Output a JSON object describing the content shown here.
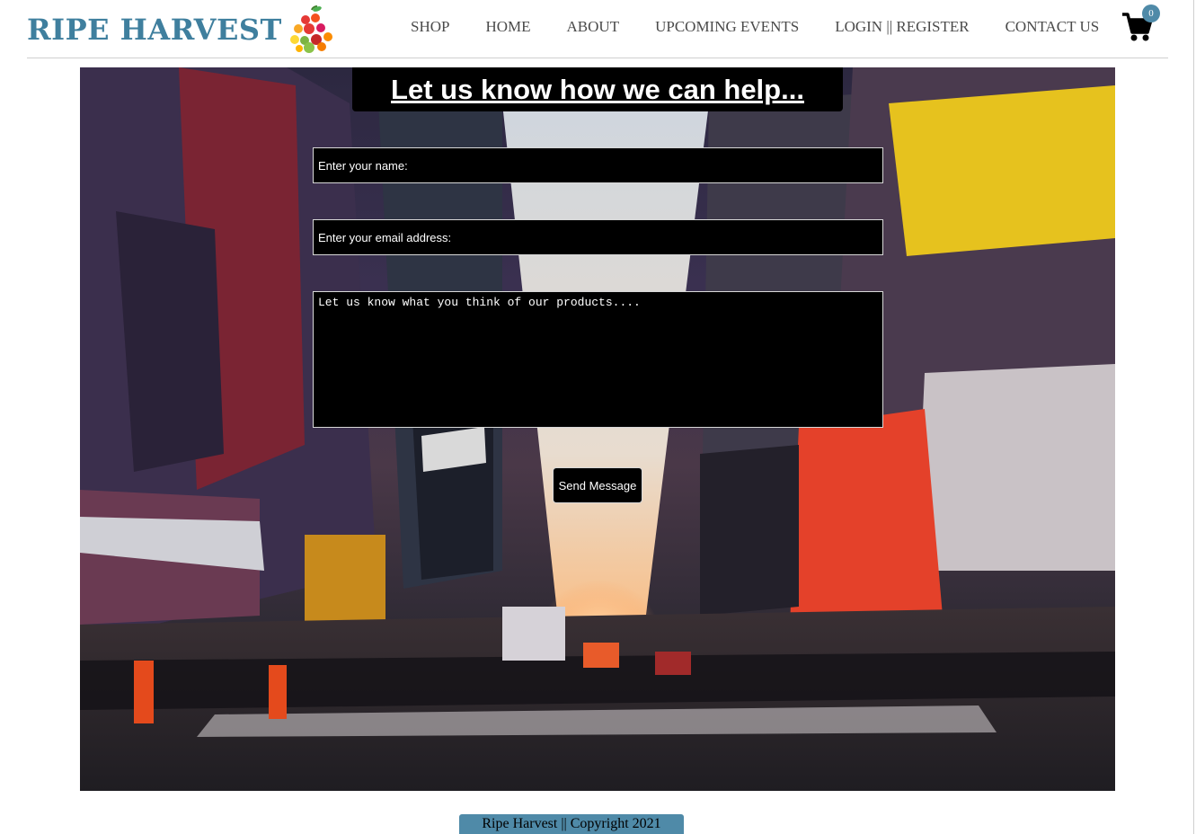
{
  "header": {
    "brand_name": "RIPE HARVEST",
    "logo_icon": "fruit-cluster-logo-icon",
    "nav": [
      {
        "label": "SHOP"
      },
      {
        "label": "HOME"
      },
      {
        "label": "ABOUT"
      },
      {
        "label": "UPCOMING EVENTS"
      },
      {
        "label": "LOGIN || REGISTER"
      },
      {
        "label": "CONTACT US"
      }
    ],
    "cart": {
      "icon": "shopping-cart-icon",
      "count": "0"
    }
  },
  "contact": {
    "heading": "Let us know how we can help...",
    "name_placeholder": "Enter your name:",
    "email_placeholder": "Enter your email address:",
    "message_placeholder": "Let us know what you think of our products....",
    "send_label": "Send Message"
  },
  "footer": {
    "text": "Ripe Harvest || Copyright 2021"
  },
  "colors": {
    "brand": "#3f7f9e",
    "accent": "#4f8aa8",
    "form_background": "#000000",
    "form_text": "#ffffff"
  }
}
